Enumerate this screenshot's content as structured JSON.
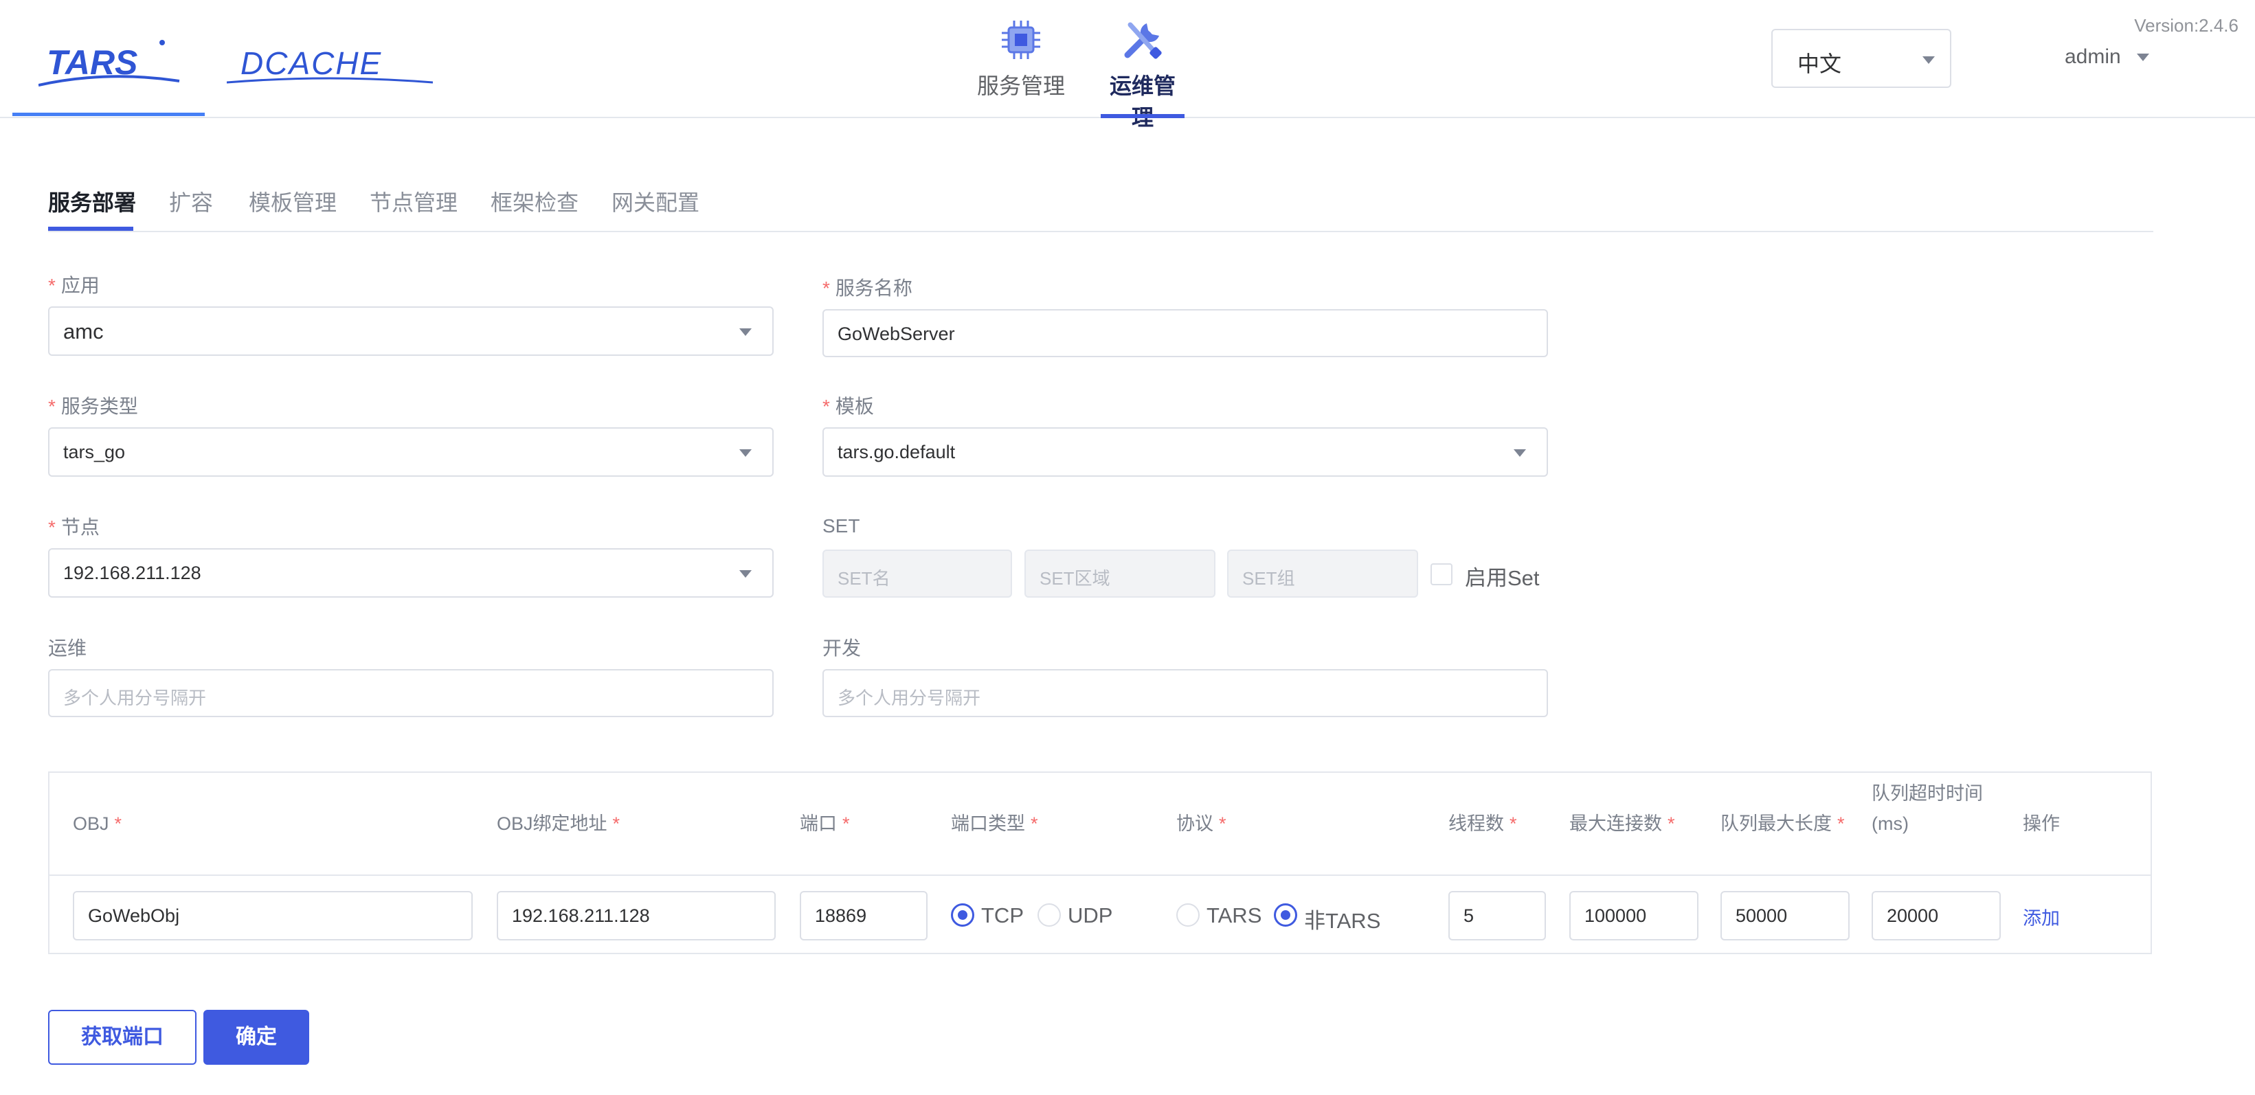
{
  "header": {
    "logos": [
      "TARS",
      "DCACHE"
    ],
    "nav": [
      {
        "label": "服务管理",
        "icon": "chip-icon",
        "active": false
      },
      {
        "label": "运维管理",
        "icon": "wrench-screwdriver-icon",
        "active": true
      }
    ],
    "language": "中文",
    "user": "admin",
    "version": "Version:2.4.6"
  },
  "tabs": [
    "服务部署",
    "扩容",
    "模板管理",
    "节点管理",
    "框架检查",
    "网关配置"
  ],
  "active_tab": "服务部署",
  "form": {
    "app": {
      "label": "应用",
      "value": "amc"
    },
    "server_name": {
      "label": "服务名称",
      "value": "GoWebServer"
    },
    "server_type": {
      "label": "服务类型",
      "value": "tars_go"
    },
    "template": {
      "label": "模板",
      "value": "tars.go.default"
    },
    "node": {
      "label": "节点",
      "value": "192.168.211.128"
    },
    "set": {
      "label": "SET",
      "name_placeholder": "SET名",
      "area_placeholder": "SET区域",
      "group_placeholder": "SET组",
      "enable_label": "启用Set",
      "enabled": false
    },
    "operator": {
      "label": "运维",
      "placeholder": "多个人用分号隔开"
    },
    "developer": {
      "label": "开发",
      "placeholder": "多个人用分号隔开"
    }
  },
  "table": {
    "headers": [
      "OBJ",
      "OBJ绑定地址",
      "端口",
      "端口类型",
      "协议",
      "线程数",
      "最大连接数",
      "队列最大长度",
      "队列超时时间(ms)",
      "操作"
    ],
    "row": {
      "obj": "GoWebObj",
      "bind_address": "192.168.211.128",
      "port": "18869",
      "port_type_options": [
        "TCP",
        "UDP"
      ],
      "port_type_selected": "TCP",
      "protocol_options": [
        "TARS",
        "非TARS"
      ],
      "protocol_selected": "非TARS",
      "threads": "5",
      "max_connections": "100000",
      "queue_max_length": "50000",
      "queue_timeout": "20000",
      "action": "添加"
    }
  },
  "buttons": {
    "get_port": "获取端口",
    "confirm": "确定"
  },
  "colors": {
    "accent": "#3f5ae0",
    "required": "#f56c6c",
    "logo": "#2f55d4"
  }
}
